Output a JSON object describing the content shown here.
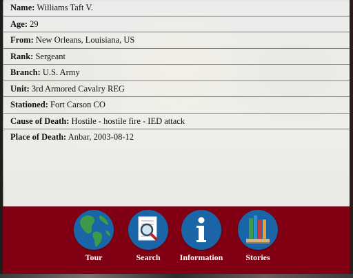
{
  "record": {
    "fields": [
      {
        "label": "Name:",
        "value": "Williams Taft V."
      },
      {
        "label": "Age:",
        "value": "29"
      },
      {
        "label": "From:",
        "value": "New Orleans, Louisiana, US"
      },
      {
        "label": "Rank:",
        "value": "Sergeant"
      },
      {
        "label": "Branch:",
        "value": "U.S. Army"
      },
      {
        "label": "Unit:",
        "value": "3rd Armored Cavalry REG"
      },
      {
        "label": "Stationed:",
        "value": "Fort Carson CO"
      },
      {
        "label": "Cause of Death:",
        "value": "Hostile - hostile fire - IED attack"
      },
      {
        "label": "Place of Death:",
        "value": "Anbar, 2003-08-12"
      }
    ]
  },
  "nav": {
    "items": [
      {
        "label": "Tour",
        "icon": "globe-icon"
      },
      {
        "label": "Search",
        "icon": "document-search-icon"
      },
      {
        "label": "Information",
        "icon": "info-icon"
      },
      {
        "label": "Stories",
        "icon": "books-icon"
      }
    ]
  },
  "colors": {
    "nav_background": "#820014",
    "icon_circle": "#1a64a8",
    "card_background": "#f8f8f4"
  }
}
